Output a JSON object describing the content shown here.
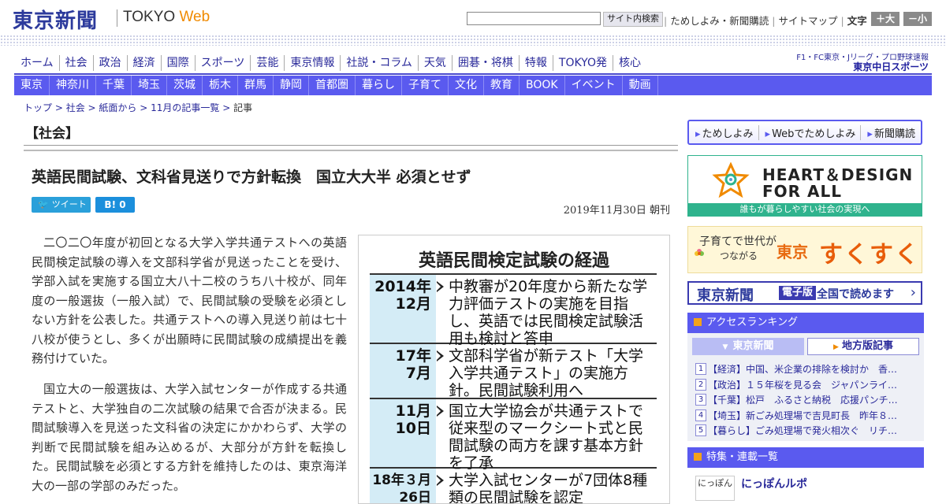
{
  "header": {
    "logo_jp": "東京新聞",
    "logo_en_main": "TOKYO",
    "logo_en_accent": "Web",
    "search_button": "サイト内検索",
    "top_links": [
      "ためしよみ・新聞購読",
      "サイトマップ"
    ],
    "text_size_label": "文字（0）",
    "size_up": "＋大",
    "size_down": "－小"
  },
  "main_nav": [
    "ホーム",
    "社会",
    "政治",
    "経済",
    "国際",
    "スポーツ",
    "芸能",
    "東京情報",
    "社説・コラム",
    "天気",
    "囲碁・将棋",
    "特報",
    "TOKYO発",
    "核心"
  ],
  "sports": {
    "sub": "F1・FC東京・Jリーグ・プロ野球速報",
    "logo": "東京中日スポーツ"
  },
  "region_nav": [
    "東京",
    "神奈川",
    "千葉",
    "埼玉",
    "茨城",
    "栃木",
    "群馬",
    "静岡",
    "首都圏",
    "暮らし",
    "子育て",
    "文化",
    "教育",
    "BOOK",
    "イベント",
    "動画"
  ],
  "breadcrumb": {
    "items": [
      "トップ",
      "社会",
      "紙面から",
      "11月の記事一覧"
    ],
    "current": "記事"
  },
  "article": {
    "section": "【社会】",
    "title": "英語民間試験、文科省見送りで方針転換　国立大大半 必須とせず",
    "tweet": "ツイート",
    "hatena": "B! 0",
    "date": "2019年11月30日 朝刊",
    "paragraphs": [
      "二〇二〇年度が初回となる大学入学共通テストへの英語民間検定試験の導入を文部科学省が見送ったことを受け、学部入試を実施する国立大八十二校のうち八十校が、同年度の一般選抜（一般入試）で、民間試験の受験を必須としない方針を公表した。共通テストへの導入見送り前は七十八校が使うとし、多くが出願時に民間試験の成績提出を義務付けていた。",
      "国立大の一般選抜は、大学入試センターが作成する共通テストと、大学独自の二次試験の結果で合否が決まる。民間試験導入を見送った文科省の決定にかかわらず、大学の判断で民間試験を組み込めるが、大部分が方針を転換した。民間試験を必須とする方針を維持したのは、東京海洋大の一部の学部のみだった。"
    ]
  },
  "figure": {
    "title": "英語民間検定試験の経過",
    "rows": [
      {
        "date": "2014年\n12月",
        "text": "中教審が20年度から新たな学力評価テストの実施を目指し、英語では民間検定試験活用も検討と答申"
      },
      {
        "date": "17年\n7月",
        "text": "文部科学省が新テスト「大学入学共通テスト」の実施方針。民間試験利用へ"
      },
      {
        "date": "11月\n10日",
        "text": "国立大学協会が共通テストで従来型のマークシート式と民間試験の両方を課す基本方針を了承"
      },
      {
        "date": "18年３月\n26日",
        "text": "大学入試センターが7団体8種類の民間試験を認定"
      }
    ]
  },
  "sidebar": {
    "links": [
      "ためしよみ",
      "Webでためしよみ",
      "新聞購読"
    ],
    "hd_line1": "HEART＆DESIGN",
    "hd_line2": "FOR ALL",
    "hd_foot": "誰もが暮らしやすい社会の実現へ",
    "suku_sub1": "子育てで世代が",
    "suku_sub2": "つながる",
    "suku_tokyo": "東京",
    "suku_main": "すくすく",
    "denshi_logo": "東京新聞",
    "denshi_tag": "電子版",
    "denshi_text": "全国で読めます",
    "ranking_title": "アクセスランキング",
    "ranking_tab1": "東京新聞",
    "ranking_tab2": "地方版記事",
    "ranking": [
      "【経済】中国、米企業の排除を検討か　香…",
      "【政治】１５年桜を見る会　ジャパンライ…",
      "【千葉】松戸　ふるさと納税　応援パンチ…",
      "【埼玉】新ごみ処理場で吉見町長　昨年８…",
      "【暮らし】ごみ処理場で発火相次ぐ　リチ…"
    ],
    "feature_title": "特集・連載一覧",
    "nippon_icon": "にっぽん",
    "nippon_title": "にっぽんルポ"
  },
  "colors": {
    "brand_blue": "#2c3a9c",
    "nav_purple": "#5a5aef",
    "accent_orange": "#f08a00",
    "hd_green": "#2fb38d"
  }
}
